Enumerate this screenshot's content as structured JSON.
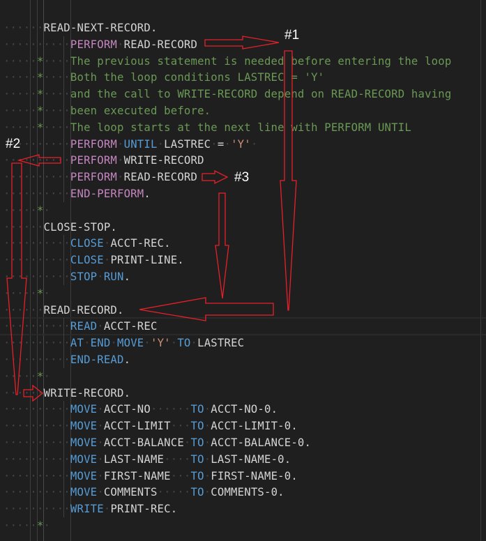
{
  "editor": {
    "language": "COBOL",
    "colors": {
      "background": "#1f1f1f",
      "keyword": "#569cd6",
      "control": "#c586c0",
      "identifier": "#d4d4d4",
      "string": "#ce9178",
      "comment": "#6a9955",
      "whitespace_marker": "#454545",
      "annotation": "#e8202a"
    },
    "lines": [
      {
        "indent": "a",
        "tokens": [
          {
            "t": "para",
            "v": "READ-NEXT-RECORD."
          }
        ]
      },
      {
        "indent": "b",
        "tokens": [
          {
            "t": "ctl",
            "v": "PERFORM"
          },
          {
            "t": "ws",
            "v": " "
          },
          {
            "t": "id",
            "v": "READ-RECORD"
          }
        ]
      },
      {
        "indent": "c",
        "tokens": [
          {
            "t": "cmt",
            "v": "The previous statement is needed before entering the loop"
          }
        ]
      },
      {
        "indent": "c",
        "tokens": [
          {
            "t": "cmt",
            "v": "Both the loop conditions LASTREC = 'Y'"
          }
        ]
      },
      {
        "indent": "c",
        "tokens": [
          {
            "t": "cmt",
            "v": "and the call to WRITE-RECORD depend on READ-RECORD having"
          }
        ]
      },
      {
        "indent": "c",
        "tokens": [
          {
            "t": "cmt",
            "v": "been executed before."
          }
        ]
      },
      {
        "indent": "c",
        "tokens": [
          {
            "t": "cmt",
            "v": "The loop starts at the next line with PERFORM UNTIL"
          }
        ]
      },
      {
        "indent": "b",
        "tokens": [
          {
            "t": "ctl",
            "v": "PERFORM"
          },
          {
            "t": "ws",
            "v": " "
          },
          {
            "t": "kw",
            "v": "UNTIL"
          },
          {
            "t": "ws",
            "v": " "
          },
          {
            "t": "id",
            "v": "LASTREC"
          },
          {
            "t": "ws",
            "v": " "
          },
          {
            "t": "id",
            "v": "="
          },
          {
            "t": "ws",
            "v": " "
          },
          {
            "t": "str",
            "v": "'Y'"
          },
          {
            "t": "ws",
            "v": " "
          }
        ]
      },
      {
        "indent": "b",
        "tokens": [
          {
            "t": "ctl",
            "v": "PERFORM"
          },
          {
            "t": "ws",
            "v": " "
          },
          {
            "t": "id",
            "v": "WRITE-RECORD"
          }
        ]
      },
      {
        "indent": "b",
        "tokens": [
          {
            "t": "ctl",
            "v": "PERFORM"
          },
          {
            "t": "ws",
            "v": " "
          },
          {
            "t": "id",
            "v": "READ-RECORD"
          }
        ]
      },
      {
        "indent": "b",
        "tokens": [
          {
            "t": "ctl",
            "v": "END-PERFORM"
          },
          {
            "t": "id",
            "v": "."
          }
        ]
      },
      {
        "indent": "star",
        "tokens": []
      },
      {
        "indent": "a",
        "tokens": [
          {
            "t": "para",
            "v": "CLOSE-STOP."
          }
        ]
      },
      {
        "indent": "b",
        "tokens": [
          {
            "t": "kw",
            "v": "CLOSE"
          },
          {
            "t": "ws",
            "v": " "
          },
          {
            "t": "id",
            "v": "ACCT-REC."
          }
        ]
      },
      {
        "indent": "b",
        "tokens": [
          {
            "t": "kw",
            "v": "CLOSE"
          },
          {
            "t": "ws",
            "v": " "
          },
          {
            "t": "id",
            "v": "PRINT-LINE."
          }
        ]
      },
      {
        "indent": "b",
        "tokens": [
          {
            "t": "kw",
            "v": "STOP"
          },
          {
            "t": "ws",
            "v": " "
          },
          {
            "t": "kw",
            "v": "RUN"
          },
          {
            "t": "id",
            "v": "."
          }
        ]
      },
      {
        "indent": "star",
        "tokens": []
      },
      {
        "indent": "a",
        "tokens": [
          {
            "t": "para",
            "v": "READ-RECORD."
          }
        ]
      },
      {
        "indent": "b",
        "current": true,
        "tokens": [
          {
            "t": "kw",
            "v": "READ"
          },
          {
            "t": "ws",
            "v": " "
          },
          {
            "t": "id",
            "v": "ACCT-REC"
          }
        ]
      },
      {
        "indent": "b",
        "tokens": [
          {
            "t": "kw",
            "v": "AT"
          },
          {
            "t": "ws",
            "v": " "
          },
          {
            "t": "kw",
            "v": "END"
          },
          {
            "t": "ws",
            "v": " "
          },
          {
            "t": "kw",
            "v": "MOVE"
          },
          {
            "t": "ws",
            "v": " "
          },
          {
            "t": "str",
            "v": "'Y'"
          },
          {
            "t": "ws",
            "v": " "
          },
          {
            "t": "kw",
            "v": "TO"
          },
          {
            "t": "ws",
            "v": " "
          },
          {
            "t": "id",
            "v": "LASTREC"
          }
        ]
      },
      {
        "indent": "b",
        "tokens": [
          {
            "t": "kw",
            "v": "END-READ"
          },
          {
            "t": "id",
            "v": "."
          }
        ]
      },
      {
        "indent": "star",
        "tokens": []
      },
      {
        "indent": "a",
        "tokens": [
          {
            "t": "para",
            "v": "WRITE-RECORD."
          }
        ]
      },
      {
        "indent": "b",
        "tokens": [
          {
            "t": "kw",
            "v": "MOVE"
          },
          {
            "t": "ws",
            "v": " "
          },
          {
            "t": "id",
            "v": "ACCT-NO"
          },
          {
            "t": "ws",
            "v": "      "
          },
          {
            "t": "kw",
            "v": "TO"
          },
          {
            "t": "ws",
            "v": " "
          },
          {
            "t": "id",
            "v": "ACCT-NO-0."
          }
        ]
      },
      {
        "indent": "b",
        "tokens": [
          {
            "t": "kw",
            "v": "MOVE"
          },
          {
            "t": "ws",
            "v": " "
          },
          {
            "t": "id",
            "v": "ACCT-LIMIT"
          },
          {
            "t": "ws",
            "v": "   "
          },
          {
            "t": "kw",
            "v": "TO"
          },
          {
            "t": "ws",
            "v": " "
          },
          {
            "t": "id",
            "v": "ACCT-LIMIT-0."
          }
        ]
      },
      {
        "indent": "b",
        "tokens": [
          {
            "t": "kw",
            "v": "MOVE"
          },
          {
            "t": "ws",
            "v": " "
          },
          {
            "t": "id",
            "v": "ACCT-BALANCE"
          },
          {
            "t": "ws",
            "v": " "
          },
          {
            "t": "kw",
            "v": "TO"
          },
          {
            "t": "ws",
            "v": " "
          },
          {
            "t": "id",
            "v": "ACCT-BALANCE-0."
          }
        ]
      },
      {
        "indent": "b",
        "tokens": [
          {
            "t": "kw",
            "v": "MOVE"
          },
          {
            "t": "ws",
            "v": " "
          },
          {
            "t": "id",
            "v": "LAST-NAME"
          },
          {
            "t": "ws",
            "v": "    "
          },
          {
            "t": "kw",
            "v": "TO"
          },
          {
            "t": "ws",
            "v": " "
          },
          {
            "t": "id",
            "v": "LAST-NAME-0."
          }
        ]
      },
      {
        "indent": "b",
        "tokens": [
          {
            "t": "kw",
            "v": "MOVE"
          },
          {
            "t": "ws",
            "v": " "
          },
          {
            "t": "id",
            "v": "FIRST-NAME"
          },
          {
            "t": "ws",
            "v": "   "
          },
          {
            "t": "kw",
            "v": "TO"
          },
          {
            "t": "ws",
            "v": " "
          },
          {
            "t": "id",
            "v": "FIRST-NAME-0."
          }
        ]
      },
      {
        "indent": "b",
        "tokens": [
          {
            "t": "kw",
            "v": "MOVE"
          },
          {
            "t": "ws",
            "v": " "
          },
          {
            "t": "id",
            "v": "COMMENTS"
          },
          {
            "t": "ws",
            "v": "     "
          },
          {
            "t": "kw",
            "v": "TO"
          },
          {
            "t": "ws",
            "v": " "
          },
          {
            "t": "id",
            "v": "COMMENTS-0."
          }
        ]
      },
      {
        "indent": "b",
        "tokens": [
          {
            "t": "kw",
            "v": "WRITE"
          },
          {
            "t": "ws",
            "v": " "
          },
          {
            "t": "id",
            "v": "PRINT-REC."
          }
        ]
      },
      {
        "indent": "star",
        "tokens": []
      }
    ]
  },
  "annotations": {
    "labels": [
      {
        "id": "label-1",
        "text": "#1"
      },
      {
        "id": "label-2",
        "text": "#2"
      },
      {
        "id": "label-3",
        "text": "#3"
      }
    ]
  }
}
